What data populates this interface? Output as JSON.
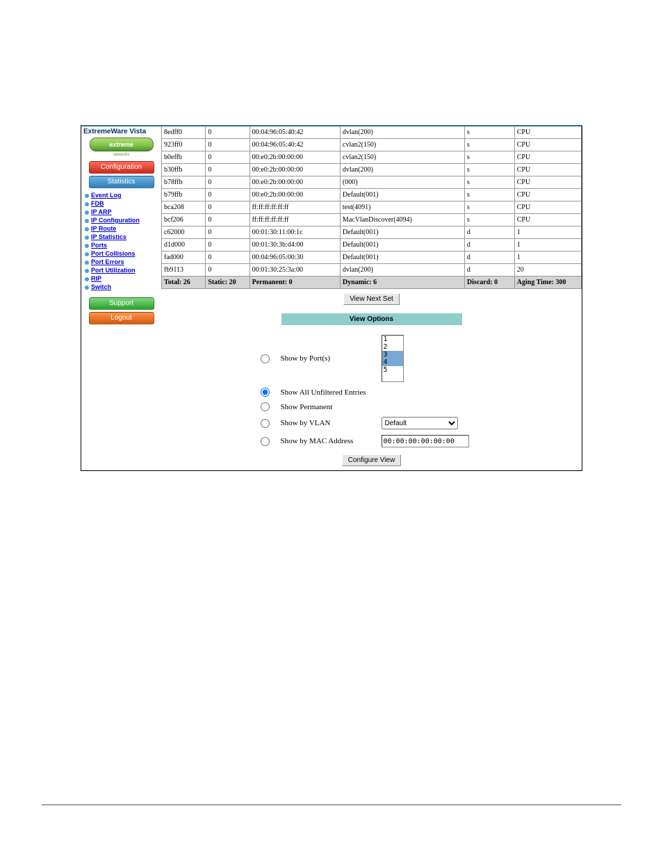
{
  "brand": {
    "title": "ExtremeWare Vista",
    "logo_text": "extreme",
    "logo_sub": "networks"
  },
  "nav_buttons": {
    "configuration": "Configuration",
    "statistics": "Statistics",
    "support": "Support",
    "logout": "Logout"
  },
  "nav_items": [
    "Event Log",
    "FDB",
    "IP ARP",
    "IP Configuration",
    "IP Route",
    "IP Statistics",
    "Ports",
    "Port Collisions",
    "Port Errors",
    "Port Utilization",
    "RIP",
    "Switch"
  ],
  "table": {
    "rows": [
      {
        "hash": "8edff0",
        "col2": "0",
        "mac": "00:04:96:05:40:42",
        "vlan": "dvlan(200)",
        "flag": "s",
        "port": "CPU"
      },
      {
        "hash": "923ff0",
        "col2": "0",
        "mac": "00:04:96:05:40:42",
        "vlan": "cvlan2(150)",
        "flag": "s",
        "port": "CPU"
      },
      {
        "hash": "b0effb",
        "col2": "0",
        "mac": "00:e0:2b:00:00:00",
        "vlan": "cvlan2(150)",
        "flag": "s",
        "port": "CPU"
      },
      {
        "hash": "b30ffb",
        "col2": "0",
        "mac": "00:e0:2b:00:00:00",
        "vlan": "dvlan(200)",
        "flag": "s",
        "port": "CPU"
      },
      {
        "hash": "b78ffb",
        "col2": "0",
        "mac": "00:e0:2b:00:00:00",
        "vlan": "(000)",
        "flag": "s",
        "port": "CPU"
      },
      {
        "hash": "b79ffb",
        "col2": "0",
        "mac": "00:e0:2b:00:00:00",
        "vlan": "Default(001)",
        "flag": "s",
        "port": "CPU"
      },
      {
        "hash": "bca208",
        "col2": "0",
        "mac": "ff:ff:ff:ff:ff:ff",
        "vlan": "test(4091)",
        "flag": "s",
        "port": "CPU"
      },
      {
        "hash": "bcf206",
        "col2": "0",
        "mac": "ff:ff:ff:ff:ff:ff",
        "vlan": "MacVlanDiscover(4094)",
        "flag": "s",
        "port": "CPU"
      },
      {
        "hash": "c62000",
        "col2": "0",
        "mac": "00:01:30:11:00:1c",
        "vlan": "Default(001)",
        "flag": "d",
        "port": "1"
      },
      {
        "hash": "d1d000",
        "col2": "0",
        "mac": "00:01:30:3b:d4:00",
        "vlan": "Default(001)",
        "flag": "d",
        "port": "1"
      },
      {
        "hash": "fad000",
        "col2": "0",
        "mac": "00:04:96:05:00:30",
        "vlan": "Default(001)",
        "flag": "d",
        "port": "1"
      },
      {
        "hash": "fb9113",
        "col2": "0",
        "mac": "00:01:30:25:3a:00",
        "vlan": "dvlan(200)",
        "flag": "d",
        "port": "20"
      }
    ],
    "summary": {
      "total": "Total: 26",
      "static": "Static: 20",
      "permanent": "Permanent: 0",
      "dynamic": "Dynamic: 6",
      "discard": "Discard: 0",
      "aging": "Aging Time: 300"
    }
  },
  "buttons": {
    "view_next": "View Next Set",
    "configure_view": "Configure View"
  },
  "view_options": {
    "header": "View Options",
    "show_by_ports": "Show by Port(s)",
    "show_all": "Show All Unfiltered Entries",
    "show_permanent": "Show Permanent",
    "show_by_vlan": "Show by VLAN",
    "show_by_mac": "Show by MAC Address",
    "vlan_default": "Default",
    "mac_value": "00:00:00:00:00:00",
    "port_options": [
      "1",
      "2",
      "3",
      "4",
      "5"
    ]
  }
}
